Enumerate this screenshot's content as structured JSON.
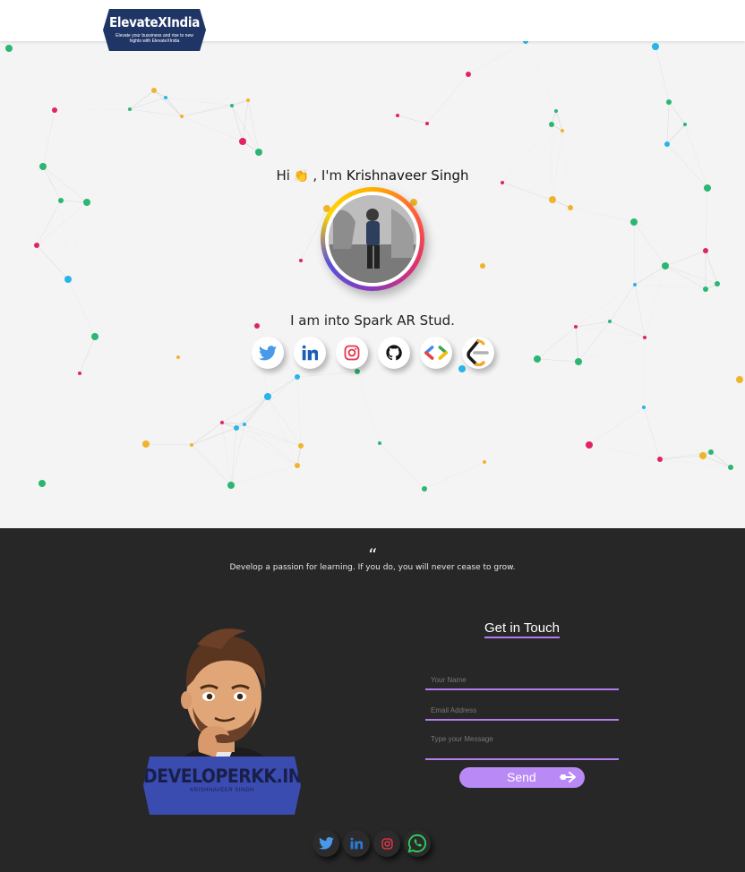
{
  "header": {
    "logo_title": "ElevateXIndia",
    "logo_subtitle": "Elevate your bussiness and rise to new hights with ElevateXIndia"
  },
  "hero": {
    "greeting_prefix": "Hi",
    "greeting_emoji": "👏",
    "greeting_middle": ", I'm",
    "name": "Krishnaveer Singh",
    "tagline": "I am into Spark AR Stud.",
    "social_icons": [
      "twitter-icon",
      "linkedin-icon",
      "instagram-icon",
      "github-icon",
      "code-icon",
      "leetcode-icon"
    ]
  },
  "quote": {
    "mark": "“",
    "text": "Develop a passion for learning. If you do, you will never cease to grow."
  },
  "badge": {
    "title": "DEVELOPERKK.IN",
    "subtitle": "KRISHNAVEER SINGH"
  },
  "contact": {
    "title": "Get in Touch",
    "name_placeholder": "Your Name",
    "email_placeholder": "Email Address",
    "message_placeholder": "Type your Message",
    "send_label": "Send"
  },
  "footer_icons": [
    "twitter-icon",
    "linkedin-icon",
    "instagram-icon",
    "whatsapp-icon"
  ],
  "colors": {
    "accent_purple": "#b98af5",
    "dark_bg": "#272727",
    "logo_navy": "#1f3566"
  }
}
